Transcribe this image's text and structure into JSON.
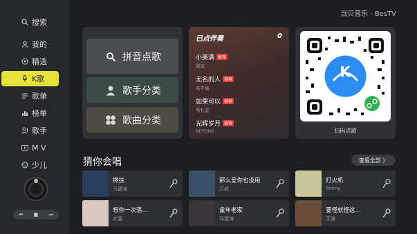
{
  "brand": "当贝音乐 · BesTV",
  "sidebar": {
    "items": [
      {
        "icon": "search-icon",
        "label": "搜索"
      },
      {
        "icon": "user-icon",
        "label": "我的"
      },
      {
        "icon": "circle-icon",
        "label": "精选"
      },
      {
        "icon": "mic-icon",
        "label": "K歌"
      },
      {
        "icon": "list-icon",
        "label": "歌单"
      },
      {
        "icon": "chart-icon",
        "label": "榜单"
      },
      {
        "icon": "singer-icon",
        "label": "歌手"
      },
      {
        "icon": "mv-icon",
        "label": "M V"
      },
      {
        "icon": "child-icon",
        "label": "少儿"
      }
    ],
    "active_index": 3
  },
  "player": {
    "prev": "⏮",
    "stop": "■",
    "next": "⏭"
  },
  "buttons": {
    "pinyin": "拼音点歌",
    "singer": "歌手分类",
    "song": "歌曲分类"
  },
  "queue": {
    "title": "已点伴奏",
    "count": "0",
    "items": [
      {
        "song": "小美满",
        "tag": "推荐",
        "artist": "周深"
      },
      {
        "song": "无名的人",
        "tag": "推荐",
        "artist": "毛不易"
      },
      {
        "song": "如果可以",
        "tag": "推荐",
        "artist": "韦礼安"
      },
      {
        "song": "光辉岁月",
        "tag": "推荐",
        "artist": "BEYOND"
      }
    ]
  },
  "qr": {
    "label": "扫码点歌",
    "center_letter": "K"
  },
  "recommend": {
    "title": "猜你会唱",
    "view_all": "查看全部 〉",
    "songs": [
      {
        "name": "搀扶",
        "artist": "马健涛",
        "color": "#2b3d5a"
      },
      {
        "name": "那么爱你也没用",
        "artist": "万叔",
        "color": "#3a5068"
      },
      {
        "name": "打火机",
        "artist": "Penny",
        "color": "#c7c79a"
      },
      {
        "name": "想你一次落...",
        "artist": "大潞",
        "color": "#d9c7c2"
      },
      {
        "name": "童年老家",
        "artist": "马健涛",
        "color": "#3a3438"
      },
      {
        "name": "要怪就怪这...",
        "artist": "王谦",
        "color": "#6a4e3a"
      }
    ]
  }
}
